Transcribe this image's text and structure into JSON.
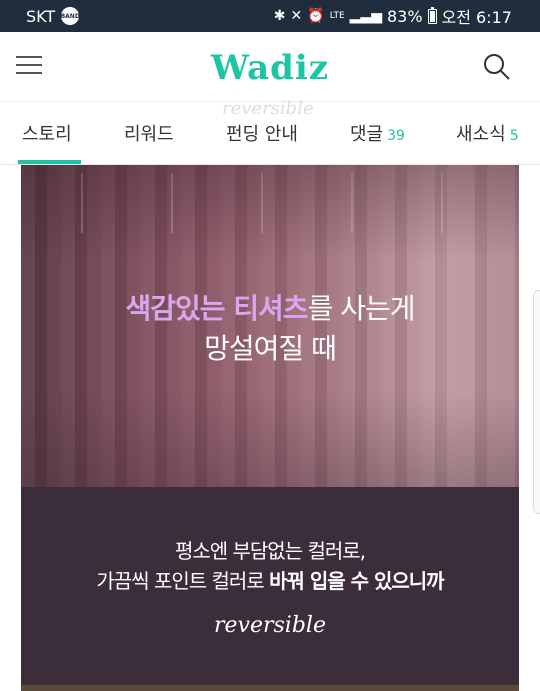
{
  "statusbar": {
    "carrier": "SKT",
    "band_badge": "BAND",
    "network": "LTE",
    "battery": "83%",
    "time": "오전 6:17",
    "battery_level": 0.83
  },
  "header": {
    "logo": "Wadiz",
    "accent_color": "#1cc5a3"
  },
  "tabs": [
    {
      "label": "스토리",
      "count": ""
    },
    {
      "label": "리워드",
      "count": ""
    },
    {
      "label": "펀딩 안내",
      "count": ""
    },
    {
      "label": "댓글",
      "count": "39"
    },
    {
      "label": "새소식",
      "count": "5"
    }
  ],
  "active_tab": "스토리",
  "banner": {
    "headline_highlight": "색감있는 티셔츠",
    "headline_rest": "를 사는게",
    "headline_line2": "망설여질 때",
    "body_line1": "평소엔 부담없는 컬러로,",
    "body_line2_plain": "가끔씩 포인트 컬러로 ",
    "body_line2_bold": "바꿔 입을 수 있으니까",
    "brand": "reversible",
    "watermark": "reversible",
    "highlight_color": "#d9a6f0",
    "dark_bg_color": "#3b2d3a"
  }
}
